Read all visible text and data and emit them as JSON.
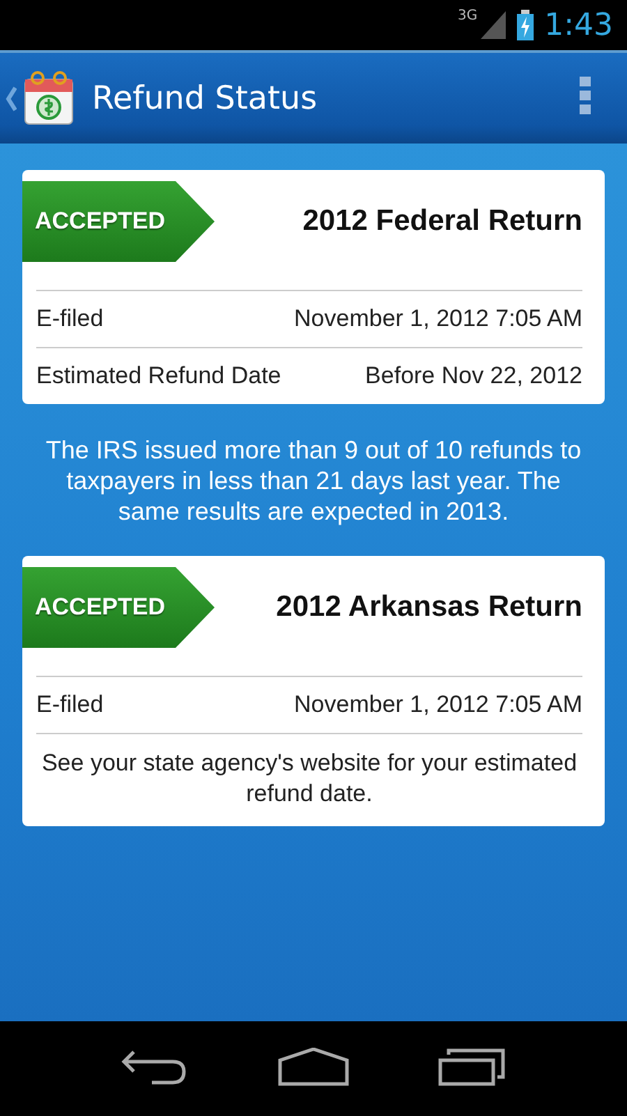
{
  "status_bar": {
    "network": "3G",
    "time": "1:43"
  },
  "app_bar": {
    "title": "Refund Status"
  },
  "returns": [
    {
      "status": "ACCEPTED",
      "title": "2012 Federal Return",
      "rows": [
        {
          "label": "E-filed",
          "value": "November 1, 2012 7:05 AM"
        },
        {
          "label": "Estimated Refund Date",
          "value": "Before Nov 22, 2012"
        }
      ]
    },
    {
      "status": "ACCEPTED",
      "title": "2012 Arkansas Return",
      "rows": [
        {
          "label": "E-filed",
          "value": "November 1, 2012 7:05 AM"
        }
      ],
      "note": "See your state agency's website for your estimated refund date."
    }
  ],
  "info": "The IRS issued more than 9 out of 10 refunds to taxpayers in less than 21 days last year. The same results are expected in 2013."
}
